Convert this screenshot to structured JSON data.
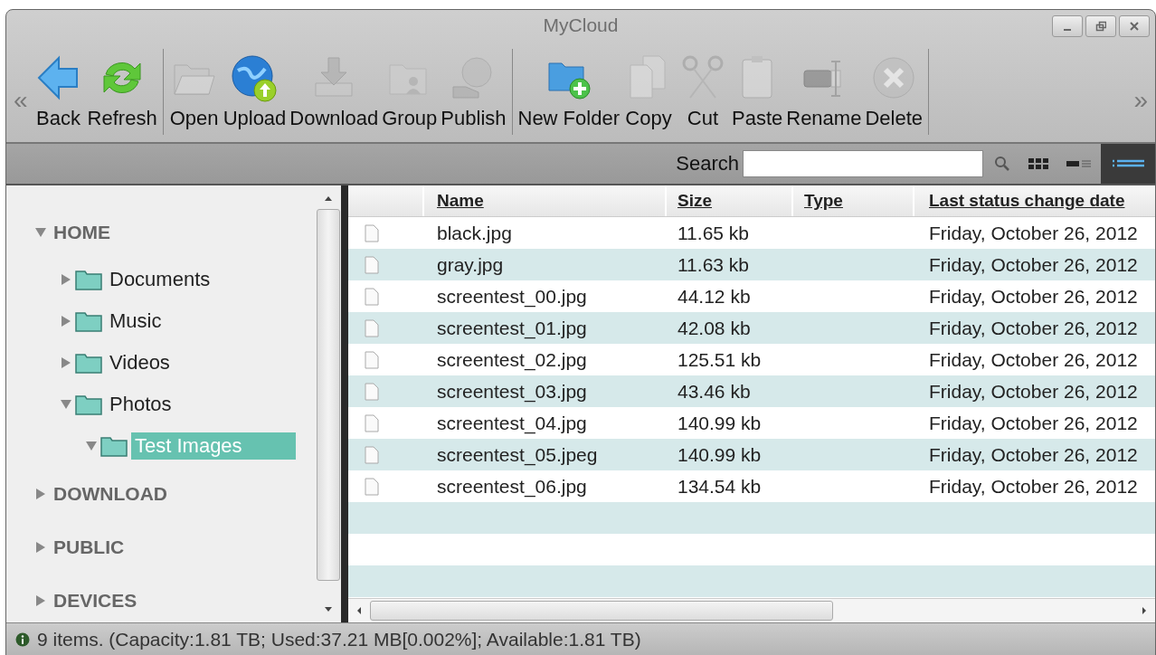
{
  "window": {
    "title": "MyCloud"
  },
  "toolbar": {
    "scroll_left": "«",
    "scroll_right": "»",
    "groups": [
      [
        {
          "kind": "back",
          "label": "Back",
          "disabled": false
        },
        {
          "kind": "refresh",
          "label": "Refresh",
          "disabled": false
        }
      ],
      [
        {
          "kind": "open",
          "label": "Open",
          "disabled": true
        },
        {
          "kind": "upload",
          "label": "Upload",
          "disabled": false
        },
        {
          "kind": "download",
          "label": "Download",
          "disabled": true
        },
        {
          "kind": "group",
          "label": "Group",
          "disabled": true
        },
        {
          "kind": "publish",
          "label": "Publish",
          "disabled": true
        }
      ],
      [
        {
          "kind": "new_folder",
          "label": "New Folder",
          "disabled": false
        },
        {
          "kind": "copy",
          "label": "Copy",
          "disabled": true
        },
        {
          "kind": "cut",
          "label": "Cut",
          "disabled": true
        },
        {
          "kind": "paste",
          "label": "Paste",
          "disabled": true
        },
        {
          "kind": "rename",
          "label": "Rename",
          "disabled": true
        },
        {
          "kind": "delete",
          "label": "Delete",
          "disabled": true
        }
      ]
    ]
  },
  "search": {
    "label": "Search"
  },
  "view_buttons": [
    {
      "kind": "icons",
      "selected": false
    },
    {
      "kind": "details",
      "selected": false
    },
    {
      "kind": "list",
      "selected": true
    }
  ],
  "tree": [
    {
      "label": "HOME",
      "kind": "root",
      "expanded": true,
      "selected": false,
      "children": [
        {
          "label": "Documents",
          "kind": "folder",
          "expanded": false,
          "selected": false
        },
        {
          "label": "Music",
          "kind": "folder",
          "expanded": false,
          "selected": false
        },
        {
          "label": "Videos",
          "kind": "folder",
          "expanded": false,
          "selected": false
        },
        {
          "label": "Photos",
          "kind": "folder",
          "expanded": true,
          "selected": false,
          "children": [
            {
              "label": "Test Images",
              "kind": "folder",
              "expanded": true,
              "selected": true
            }
          ]
        }
      ]
    },
    {
      "label": "DOWNLOAD",
      "kind": "root",
      "expanded": false,
      "selected": false
    },
    {
      "label": "PUBLIC",
      "kind": "root",
      "expanded": false,
      "selected": false
    },
    {
      "label": "DEVICES",
      "kind": "root",
      "expanded": false,
      "selected": false
    }
  ],
  "table": {
    "columns": [
      "Name",
      "Size",
      "Type",
      "Last status change date"
    ],
    "rows": [
      {
        "name": "black.jpg",
        "size": "11.65 kb",
        "date": "Friday, October 26, 2012"
      },
      {
        "name": "gray.jpg",
        "size": "11.63 kb",
        "date": "Friday, October 26, 2012"
      },
      {
        "name": "screentest_00.jpg",
        "size": "44.12 kb",
        "date": "Friday, October 26, 2012"
      },
      {
        "name": "screentest_01.jpg",
        "size": "42.08 kb",
        "date": "Friday, October 26, 2012"
      },
      {
        "name": "screentest_02.jpg",
        "size": "125.51 kb",
        "date": "Friday, October 26, 2012"
      },
      {
        "name": "screentest_03.jpg",
        "size": "43.46 kb",
        "date": "Friday, October 26, 2012"
      },
      {
        "name": "screentest_04.jpg",
        "size": "140.99 kb",
        "date": "Friday, October 26, 2012"
      },
      {
        "name": "screentest_05.jpeg",
        "size": "140.99 kb",
        "date": "Friday, October 26, 2012"
      },
      {
        "name": "screentest_06.jpg",
        "size": "134.54 kb",
        "date": "Friday, October 26, 2012"
      }
    ]
  },
  "status_bar": "9 items. (Capacity:1.81 TB; Used:37.21 MB[0.002%]; Available:1.81 TB)"
}
